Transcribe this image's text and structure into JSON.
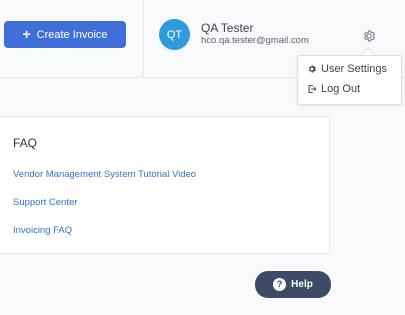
{
  "header": {
    "create_invoice_label": "Create Invoice",
    "create_invoice_icon": "plus-icon",
    "user": {
      "initials": "QT",
      "name": "QA Tester",
      "email": "hco.qa.tester@gmail.com",
      "avatar_color": "#2e9bdc"
    },
    "settings_icon": "gear-icon"
  },
  "user_menu": {
    "items": [
      {
        "label": "User Settings",
        "icon": "gear-icon"
      },
      {
        "label": "Log Out",
        "icon": "logout-icon"
      }
    ]
  },
  "faq": {
    "title": "FAQ",
    "links": [
      "Vendor Management System Tutorial Video",
      "Support Center",
      "Invoicing FAQ"
    ]
  },
  "help": {
    "label": "Help",
    "icon": "question-icon",
    "icon_glyph": "?"
  },
  "colors": {
    "primary": "#3f6fd8",
    "link": "#3672c9",
    "help_bg": "#3d4b66"
  }
}
